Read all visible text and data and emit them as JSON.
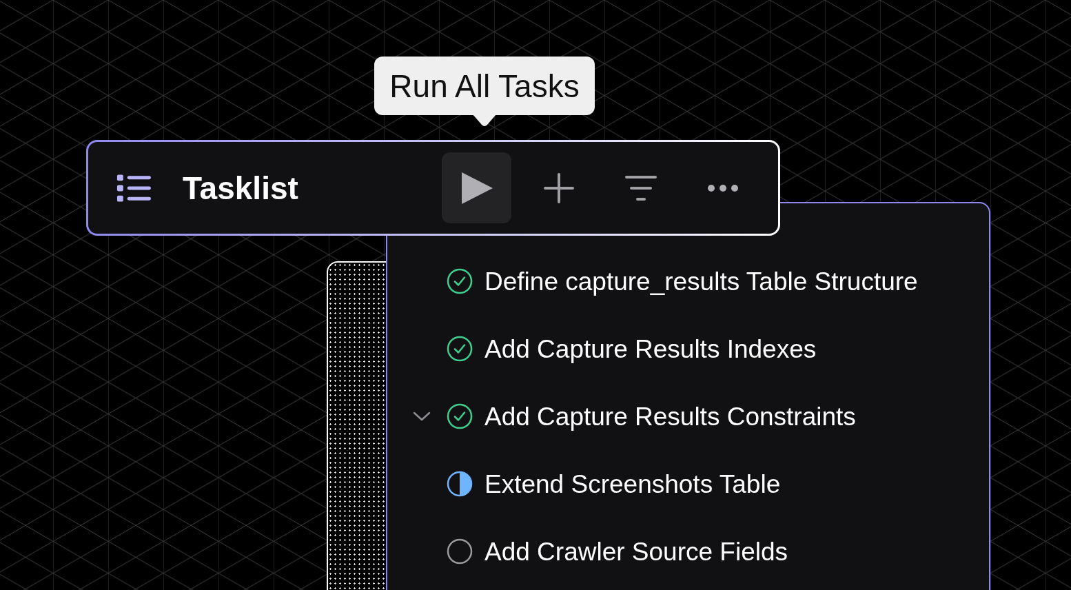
{
  "tooltip": {
    "text": "Run All Tasks"
  },
  "header": {
    "title": "Tasklist"
  },
  "tasks": [
    {
      "title": "Define capture_results Table Structure",
      "kind": "done",
      "expanded": false
    },
    {
      "title": "Add Capture Results Indexes",
      "kind": "done",
      "expanded": false
    },
    {
      "title": "Add Capture Results Constraints",
      "kind": "done",
      "expanded": true
    },
    {
      "title": "Extend Screenshots Table",
      "kind": "in_progress",
      "expanded": false
    },
    {
      "title": "Add Crawler Source Fields",
      "kind": "todo",
      "expanded": false
    }
  ]
}
